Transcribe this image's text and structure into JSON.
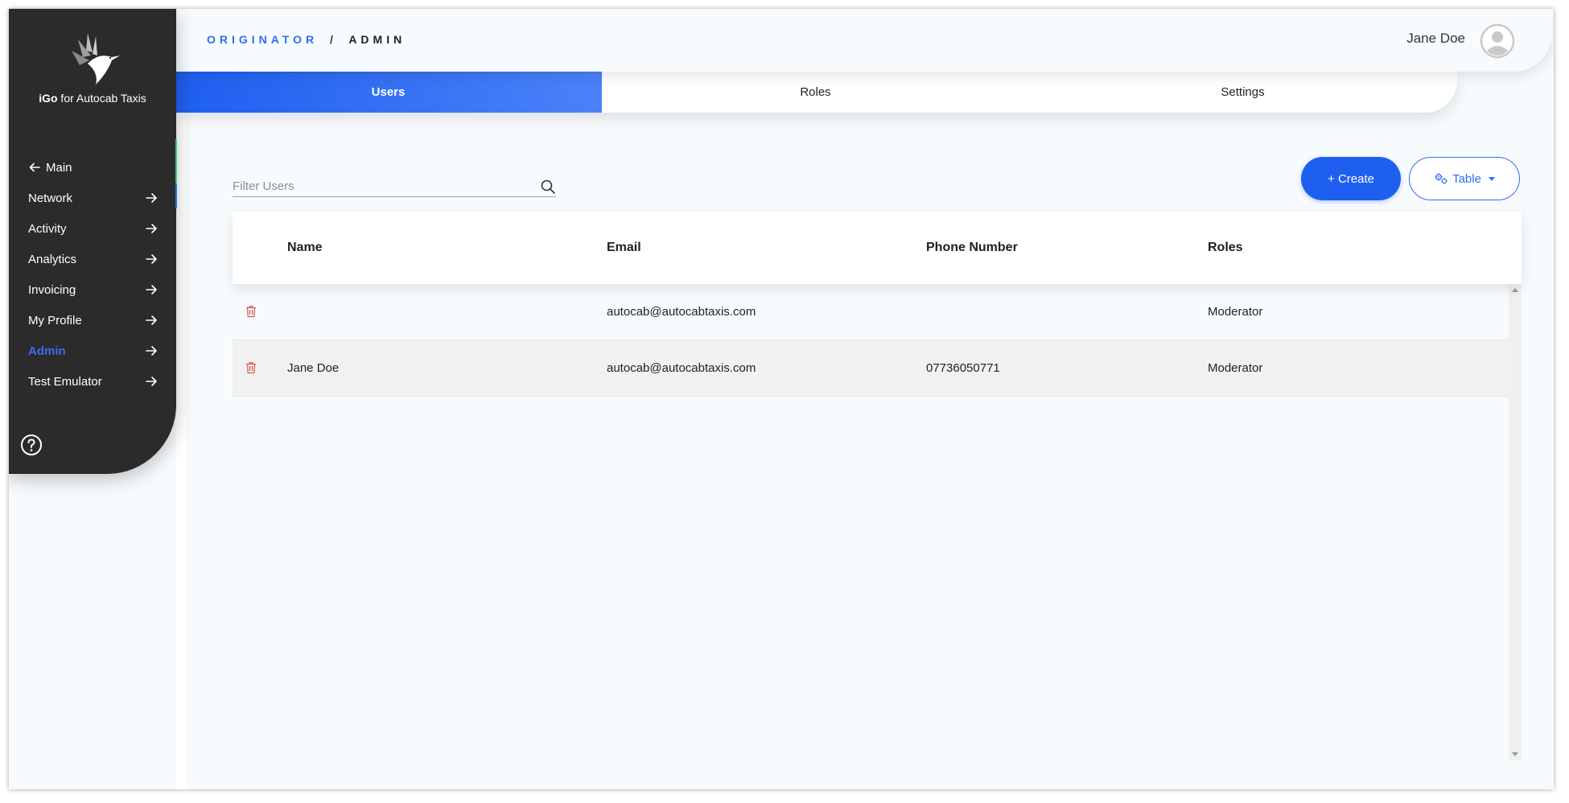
{
  "sidebar": {
    "brand_prefix": "iGo",
    "brand_suffix": " for Autocab Taxis",
    "main_label": "Main",
    "items": [
      {
        "label": "Network"
      },
      {
        "label": "Activity"
      },
      {
        "label": "Analytics"
      },
      {
        "label": "Invoicing"
      },
      {
        "label": "My Profile"
      },
      {
        "label": "Admin",
        "active": true
      },
      {
        "label": "Test Emulator"
      }
    ],
    "accent_color": "#2d6df6"
  },
  "header": {
    "breadcrumb_root": "ORIGINATOR",
    "breadcrumb_sep": "/",
    "breadcrumb_current": "ADMIN",
    "user_name": "Jane Doe"
  },
  "tabs": [
    {
      "label": "Users",
      "active": true
    },
    {
      "label": "Roles"
    },
    {
      "label": "Settings"
    }
  ],
  "toolbar": {
    "filter_placeholder": "Filter Users",
    "create_label": "+ Create",
    "table_label": "Table"
  },
  "table": {
    "columns": [
      "Name",
      "Email",
      "Phone Number",
      "Roles"
    ],
    "rows": [
      {
        "name": "",
        "email": "autocab@autocabtaxis.com",
        "phone": "",
        "roles": "Moderator"
      },
      {
        "name": "Jane Doe",
        "email": "autocab@autocabtaxis.com",
        "phone": "07736050771",
        "roles": "Moderator"
      }
    ]
  },
  "colors": {
    "primary": "#1f5ff0",
    "sidebar_bg": "#2b2b2b",
    "delete": "#e05a5a"
  },
  "icons": [
    "back-arrow-icon",
    "arrow-right-icon",
    "help-icon",
    "user-avatar-icon",
    "search-icon",
    "settings-gears-icon",
    "trash-icon",
    "hummingbird-logo"
  ]
}
